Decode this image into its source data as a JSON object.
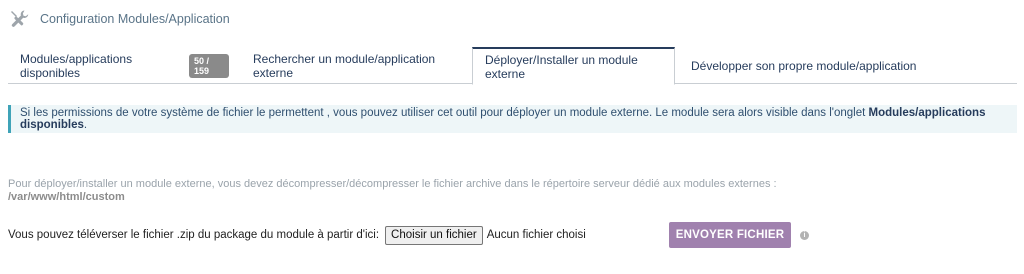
{
  "header": {
    "icon": "tools-icon",
    "title": "Configuration Modules/Application"
  },
  "tabs": [
    {
      "label": "Modules/applications disponibles",
      "badge": "50 / 159"
    },
    {
      "label": "Rechercher un module/application externe"
    },
    {
      "label": "Déployer/Installer un module externe",
      "active": true
    },
    {
      "label": "Développer son propre module/application"
    }
  ],
  "info": {
    "text": "Si les permissions de votre système de fichier le permettent , vous pouvez utiliser cet outil pour déployer un module externe. Le module sera alors visible dans l'onglet ",
    "bold": "Modules/applications disponibles",
    "end": "."
  },
  "hint": {
    "text": "Pour déployer/installer un module externe, vous devez décompresser/décompresser le fichier archive dans le répertoire serveur dédié aux modules externes :",
    "path": "/var/www/html/custom"
  },
  "upload": {
    "label": "Vous pouvez téléverser le fichier .zip du package du module à partir d'ici:",
    "choose_button": "Choisir un fichier",
    "status": "Aucun fichier choisi",
    "send_button": "ENVOYER FICHIER",
    "help_icon": "info-icon"
  },
  "colors": {
    "accent": "#263c5c",
    "send_button": "#a081ae",
    "info_border": "#3fa3b8",
    "info_bg": "#eef6f8"
  }
}
